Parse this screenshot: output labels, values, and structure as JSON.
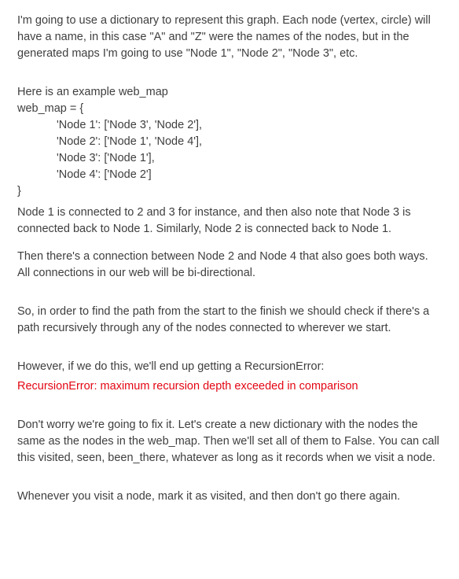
{
  "intro": "I'm going to use a dictionary to represent this graph.  Each node (vertex, circle) will have a name, in this case \"A\" and \"Z\" were the names of the nodes, but in the generated maps I'm going to use \"Node 1\", \"Node 2\", \"Node 3\", etc.",
  "example_label": "Here is an example web_map",
  "code": {
    "l1": "web_map = {",
    "l2": "'Node 1': ['Node 3', 'Node 2'],",
    "l3": "'Node 2': ['Node 1', 'Node 4'],",
    "l4": "'Node 3': ['Node 1'],",
    "l5": "'Node 4': ['Node 2']",
    "l6": "}"
  },
  "explain1": "Node 1 is connected to 2 and 3 for instance, and then also note that Node 3 is connected back to Node 1.  Similarly, Node 2 is connected back to Node 1.",
  "explain2": "Then there's a connection between Node 2 and Node 4 that also goes both ways.  All connections in our web will be bi-directional.",
  "explain3": "So, in order to find the path from the start to the finish we should check if there's a path recursively through any of the nodes connected to wherever we start.",
  "explain4": "However, if we do this, we'll end up getting a RecursionError:",
  "error_line": "RecursionError: maximum recursion depth exceeded in comparison",
  "explain5": "Don't worry we're going to fix it.  Let's create a new dictionary with the nodes the same as the nodes in the web_map.  Then we'll set all of them to False.  You can call this visited, seen, been_there, whatever as long as it records when we visit a node.",
  "explain6": "Whenever you visit a node, mark it as visited, and then don't go there again."
}
